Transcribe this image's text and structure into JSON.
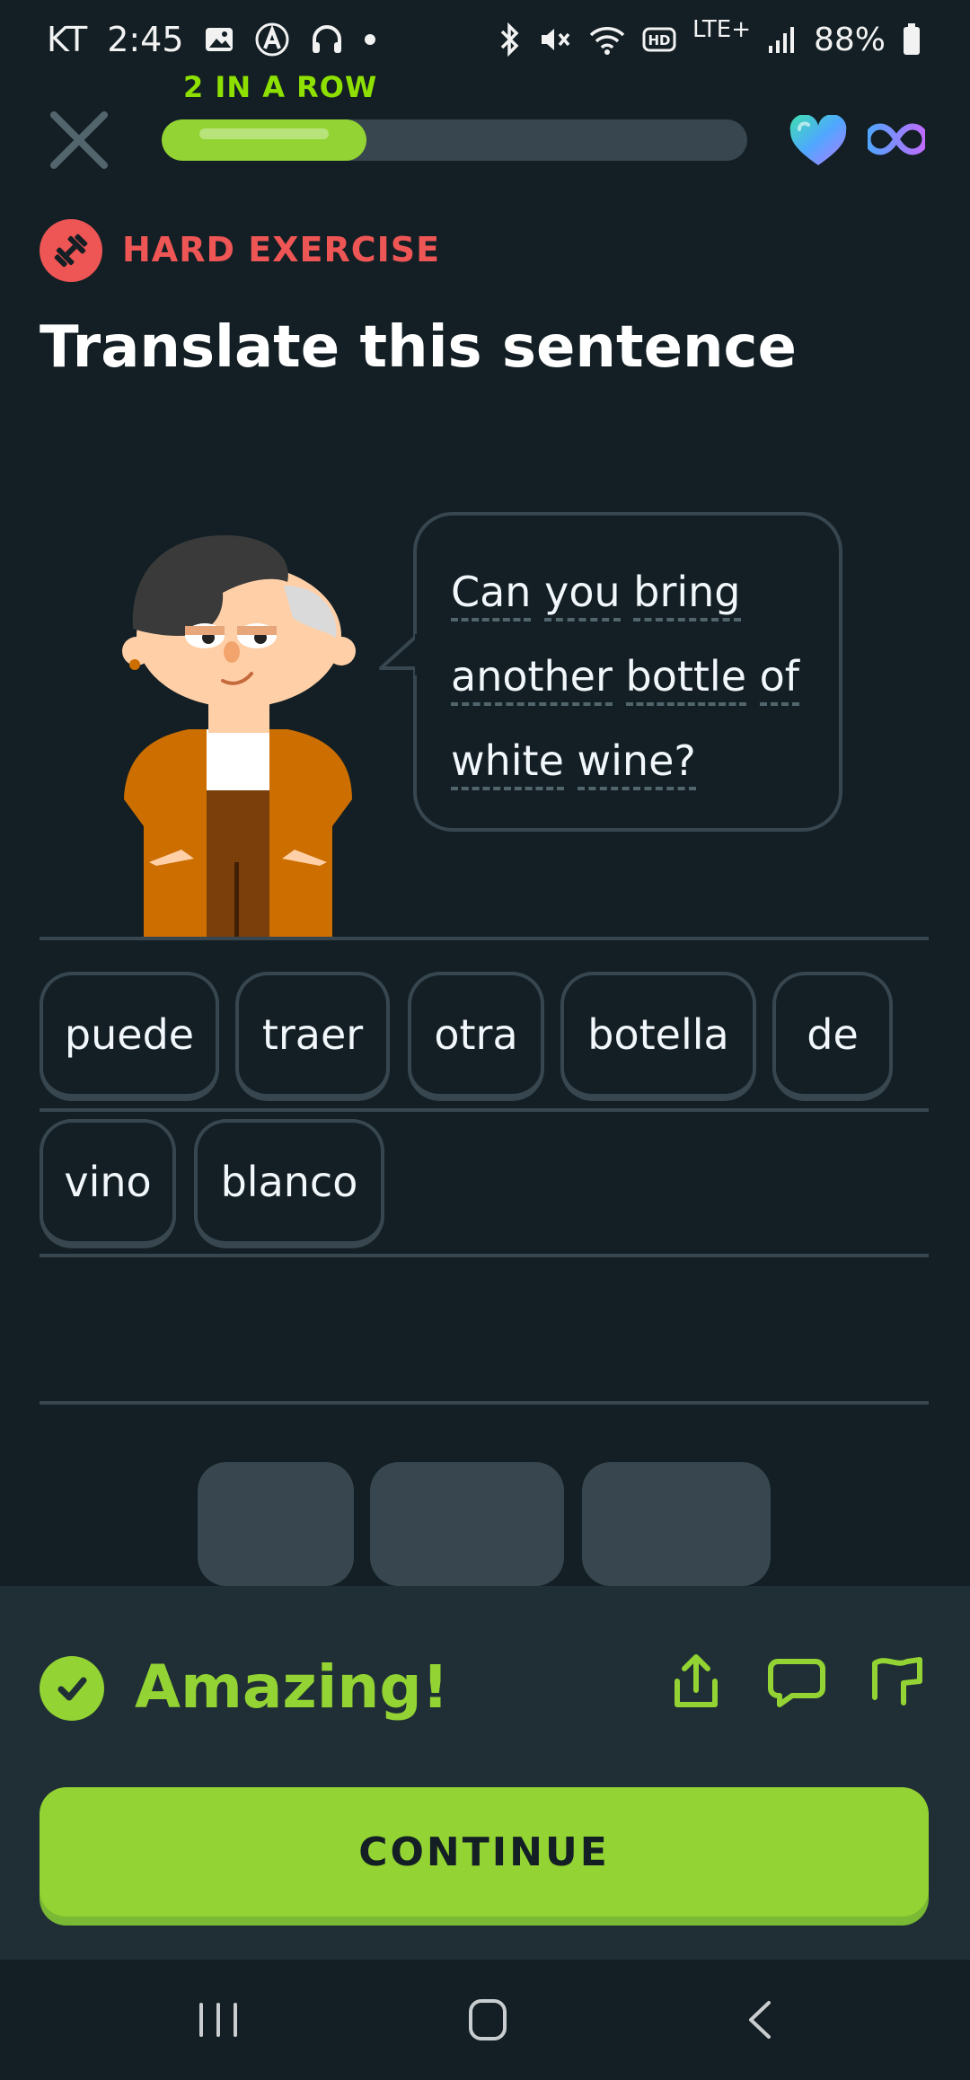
{
  "status_bar": {
    "carrier": "KT",
    "time": "2:45",
    "battery": "88%",
    "network": "LTE+"
  },
  "header": {
    "streak_text": "2 IN A ROW",
    "progress_fraction": 0.35,
    "lives": "infinite"
  },
  "exercise": {
    "badge_label": "HARD EXERCISE",
    "title": "Translate this sentence",
    "prompt_lines": [
      [
        "Can",
        "you",
        "bring"
      ],
      [
        "another",
        "bottle",
        "of"
      ],
      [
        "white",
        "wine?"
      ]
    ]
  },
  "answer": {
    "row1": [
      "puede",
      "traer",
      "otra",
      "botella",
      "de"
    ],
    "row2": [
      "vino",
      "blanco"
    ]
  },
  "feedback": {
    "title": "Amazing!",
    "continue_label": "CONTINUE"
  },
  "colors": {
    "background": "#131f24",
    "accent_green": "#93d333",
    "hard_red": "#ee5555",
    "tile_border": "#37464f"
  },
  "icons": [
    "close-icon",
    "heart-icon",
    "infinity-icon",
    "dumbbell-icon",
    "check-icon",
    "share-icon",
    "comment-icon",
    "flag-icon",
    "recents-icon",
    "home-icon",
    "back-icon"
  ]
}
